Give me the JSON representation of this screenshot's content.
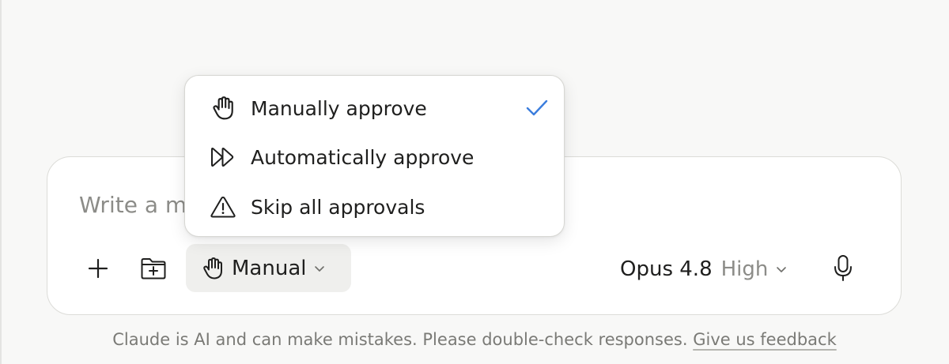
{
  "composer": {
    "placeholder": "Write a message...",
    "add_icon": "plus-icon",
    "folder_icon": "folder-plus-icon",
    "mode": {
      "icon": "hand-icon",
      "label": "Manual"
    },
    "model": {
      "name": "Opus 4.8",
      "effort": "High"
    },
    "mic_icon": "microphone-icon"
  },
  "approval_menu": {
    "items": [
      {
        "label": "Manually approve",
        "icon": "hand-icon",
        "selected": true
      },
      {
        "label": "Automatically approve",
        "icon": "fast-forward-icon",
        "selected": false
      },
      {
        "label": "Skip all approvals",
        "icon": "warning-icon",
        "selected": false
      }
    ]
  },
  "footer": {
    "disclaimer": "Claude is AI and can make mistakes. Please double-check responses.",
    "feedback_link": "Give us feedback"
  },
  "colors": {
    "page_bg": "#f8f8f7",
    "accent_check": "#3b7ddd",
    "muted_text": "#8c8c88"
  }
}
